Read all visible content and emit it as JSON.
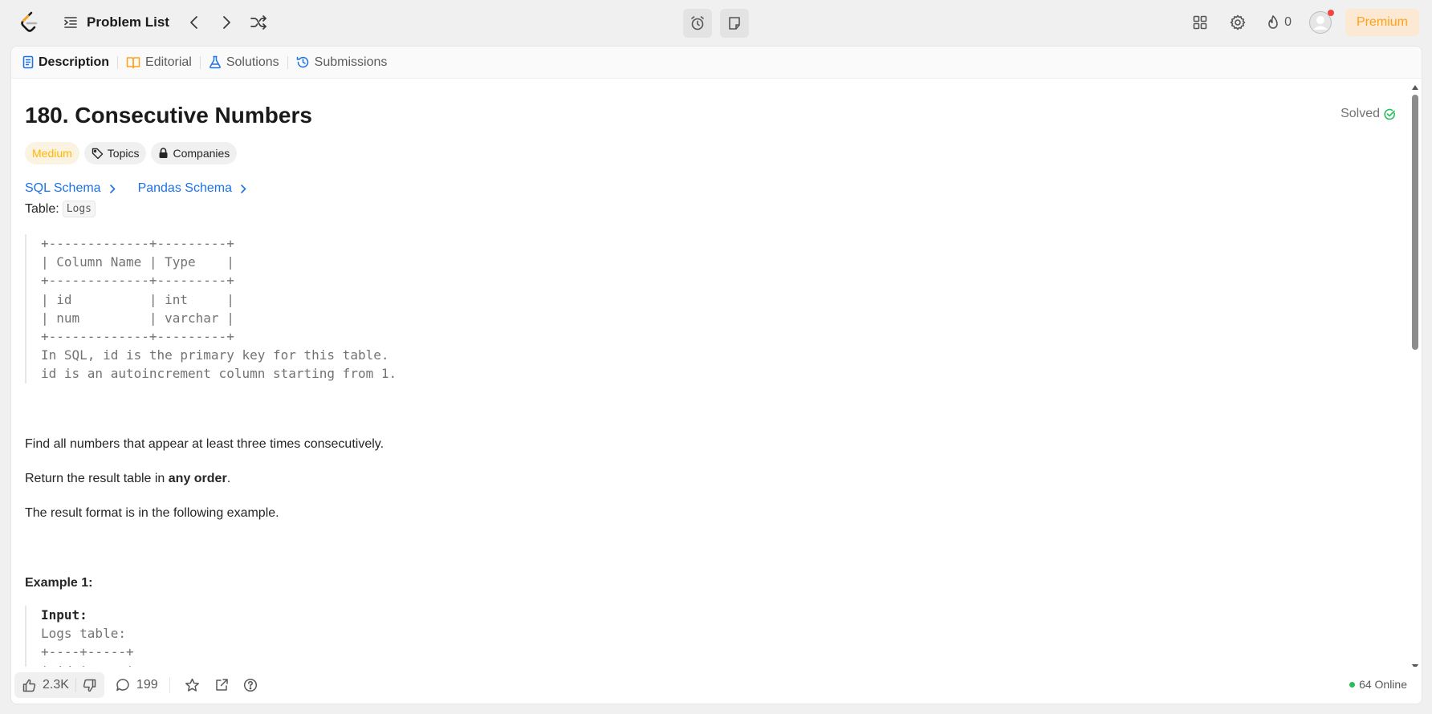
{
  "nav": {
    "problem_list": "Problem List",
    "streak_count": "0",
    "premium": "Premium"
  },
  "tabs": [
    {
      "label": "Description"
    },
    {
      "label": "Editorial"
    },
    {
      "label": "Solutions"
    },
    {
      "label": "Submissions"
    }
  ],
  "problem": {
    "title": "180. Consecutive Numbers",
    "status": "Solved",
    "difficulty": "Medium",
    "topics": "Topics",
    "companies": "Companies",
    "schemas": [
      "SQL Schema",
      "Pandas Schema"
    ],
    "table_label": "Table:",
    "table_name": "Logs",
    "schema_block": "+-------------+---------+\n| Column Name | Type    |\n+-------------+---------+\n| id          | int     |\n| num         | varchar |\n+-------------+---------+\nIn SQL, id is the primary key for this table.\nid is an autoincrement column starting from 1.",
    "desc1": "Find all numbers that appear at least three times consecutively.",
    "desc2_pre": "Return the result table in ",
    "desc2_bold": "any order",
    "desc2_post": ".",
    "desc3": "The result format is in the following example.",
    "example_title": "Example 1:",
    "example_input_label": "Input:",
    "example_block": "Logs table:\n+----+-----+\n| id | num |"
  },
  "footer": {
    "likes": "2.3K",
    "comments": "199",
    "online": "64 Online"
  },
  "colors": {
    "accent": "#ffa116",
    "link": "#1a73e8",
    "success": "#2cbb5d",
    "medium": "#ffb800"
  }
}
